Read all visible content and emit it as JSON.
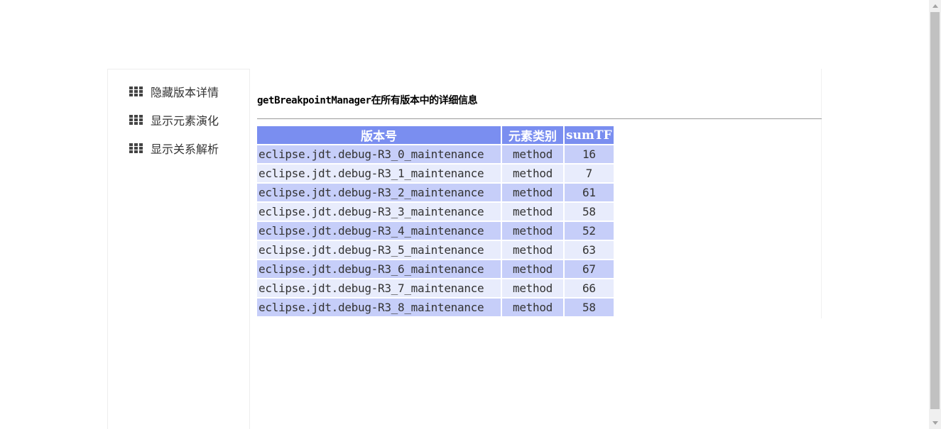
{
  "sidebar": {
    "items": [
      {
        "label": "隐藏版本详情",
        "icon": "grid-icon"
      },
      {
        "label": "显示元素演化",
        "icon": "grid-icon"
      },
      {
        "label": "显示关系解析",
        "icon": "grid-icon"
      }
    ]
  },
  "main": {
    "title": "getBreakpointManager在所有版本中的详细信息",
    "table": {
      "headers": [
        "版本号",
        "元素类别",
        "sumTF"
      ],
      "rows": [
        {
          "version": "eclipse.jdt.debug-R3_0_maintenance",
          "type": "method",
          "sumTF": "16"
        },
        {
          "version": "eclipse.jdt.debug-R3_1_maintenance",
          "type": "method",
          "sumTF": "7"
        },
        {
          "version": "eclipse.jdt.debug-R3_2_maintenance",
          "type": "method",
          "sumTF": "61"
        },
        {
          "version": "eclipse.jdt.debug-R3_3_maintenance",
          "type": "method",
          "sumTF": "58"
        },
        {
          "version": "eclipse.jdt.debug-R3_4_maintenance",
          "type": "method",
          "sumTF": "52"
        },
        {
          "version": "eclipse.jdt.debug-R3_5_maintenance",
          "type": "method",
          "sumTF": "63"
        },
        {
          "version": "eclipse.jdt.debug-R3_6_maintenance",
          "type": "method",
          "sumTF": "67"
        },
        {
          "version": "eclipse.jdt.debug-R3_7_maintenance",
          "type": "method",
          "sumTF": "66"
        },
        {
          "version": "eclipse.jdt.debug-R3_8_maintenance",
          "type": "method",
          "sumTF": "58"
        }
      ]
    }
  },
  "colors": {
    "header_bg": "#7a8ef0",
    "row_odd_bg": "#c6cef9",
    "row_even_bg": "#e8ecfc"
  }
}
